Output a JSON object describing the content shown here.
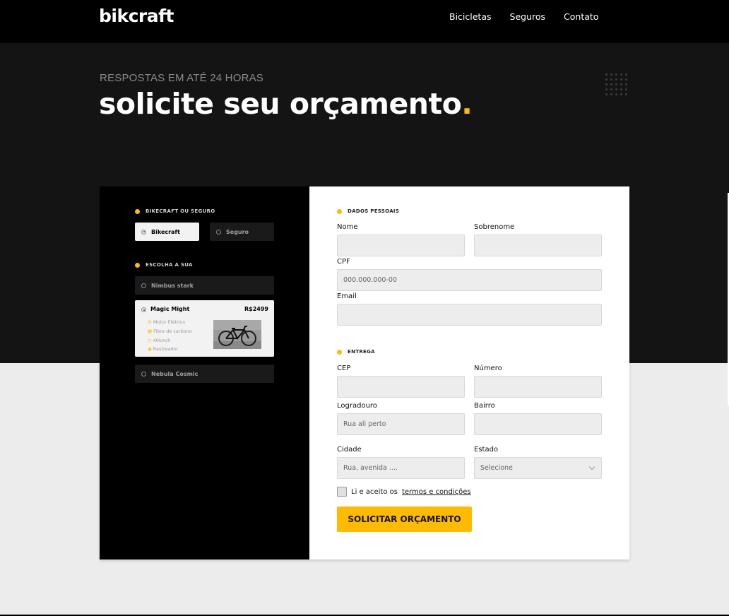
{
  "header": {
    "logo": "bikcraft",
    "nav": [
      "Bicicletas",
      "Seguros",
      "Contato"
    ]
  },
  "hero": {
    "kicker": "RESPOSTAS EM ATÉ 24 HORAS",
    "title": "solicite seu orçamento",
    "title_dot": "."
  },
  "left_panel": {
    "section1_title": "BIKECRAFT OU SEGURO",
    "options": [
      "Bikecraft",
      "Seguro"
    ],
    "selected_option": "Bikecraft",
    "section2_title": "ESCOLHA A SUA",
    "bikes": [
      {
        "name": "Nimbus stark"
      },
      {
        "name": "Magic Might",
        "price": "R$2499",
        "features": [
          "Motor Elétrico",
          "Fibra de carbono",
          "40km/h",
          "Rastreador"
        ]
      },
      {
        "name": "Nebula Cosmic"
      }
    ],
    "selected_bike": "Magic Might"
  },
  "form": {
    "personal_title": "DADOS PESSOAIS",
    "nome_label": "Nome",
    "sobrenome_label": "Sobrenome",
    "cpf_label": "CPF",
    "cpf_placeholder": "000.000.000-00",
    "email_label": "Email",
    "delivery_title": "ENTREGA",
    "cep_label": "CEP",
    "numero_label": "Número",
    "logradouro_label": "Logradouro",
    "logradouro_placeholder": "Rua ali perto",
    "bairro_label": "Bairro",
    "cidade_label": "Cidade",
    "cidade_placeholder": "Rua, avenida ....",
    "estado_label": "Estado",
    "estado_value": "Selecione",
    "terms_prefix": "Li e aceito os",
    "terms_link": "termos e condições",
    "submit_label": "SOLICITAR ORÇAMENTO"
  },
  "colors": {
    "accent": "#ffbb00",
    "header_bg": "#000000",
    "hero_bg": "#141414",
    "page_bg": "#ececec"
  }
}
